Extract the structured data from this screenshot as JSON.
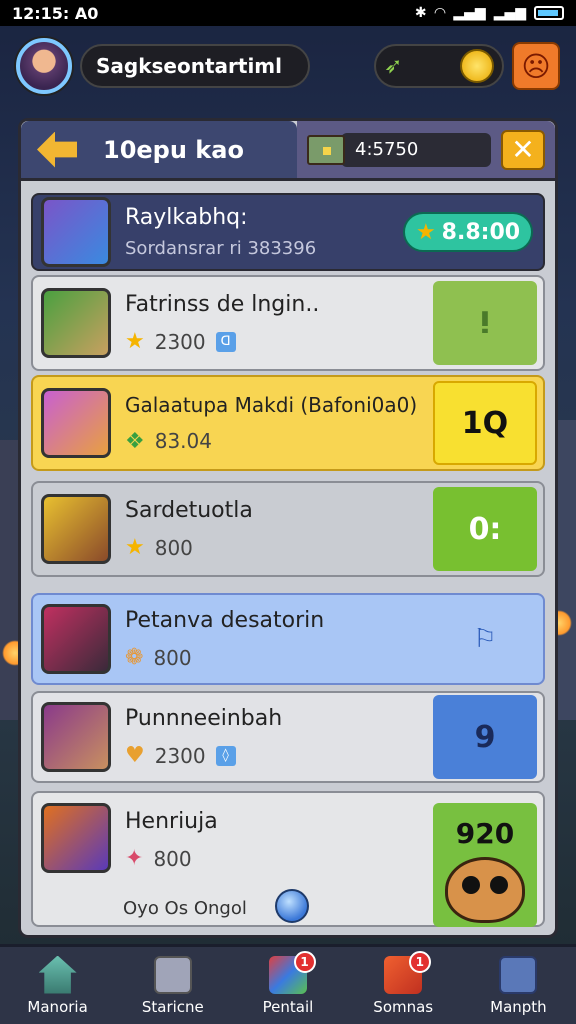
{
  "status_bar": {
    "time": "12:15: A0"
  },
  "header": {
    "player_name": "Sagkseontartiml"
  },
  "panel": {
    "title": "10epu kao",
    "resource_value": "4:5750"
  },
  "self_row": {
    "name": "Raylkabhq:",
    "subtitle": "Sordansrar ri 383396",
    "score": "8.8:00"
  },
  "rows": [
    {
      "name": "Fatrinss de lngin..",
      "value": "2300",
      "action": "ⵑ",
      "color": "#8fc050"
    },
    {
      "name": "Galaatupa Makdi (Bafoni0a0)",
      "value": "83.04",
      "action": "1Q",
      "color": "#f8d552"
    },
    {
      "name": "Sardetuotla",
      "value": "800",
      "action": "0:",
      "color": "#78c030"
    },
    {
      "name": "Petanva desatorin",
      "value": "800",
      "action": "⚐",
      "color": "#a9c6f5"
    },
    {
      "name": "Punnneeinbah",
      "value": "2300",
      "action": "9",
      "color": "#4a80d8"
    },
    {
      "name": "Henriuja",
      "value": "800",
      "footer": "Oyo Os Ongol",
      "action": "920",
      "color": "#78c040"
    }
  ],
  "bottom_nav": [
    {
      "label": "Manoria",
      "icon": "home-icon"
    },
    {
      "label": "Staricne",
      "icon": "gift-icon"
    },
    {
      "label": "Pentail",
      "icon": "map-icon",
      "badge": "1"
    },
    {
      "label": "Somnas",
      "icon": "ticket-icon",
      "badge": "1"
    },
    {
      "label": "Manpth",
      "icon": "box-icon"
    }
  ]
}
